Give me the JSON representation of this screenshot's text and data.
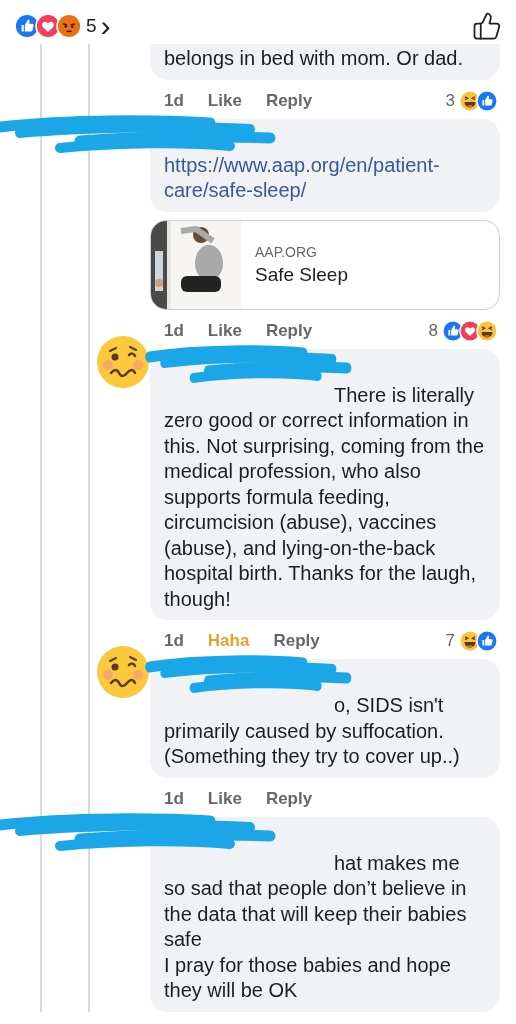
{
  "header": {
    "reactions": [
      {
        "kind": "like"
      },
      {
        "kind": "love"
      },
      {
        "kind": "angry"
      }
    ],
    "count": "5",
    "chevron": "›"
  },
  "comments": [
    {
      "redacted": false,
      "avatar_sticker": false,
      "text": "belongs in bed with mom. Or dad.",
      "time": "1d",
      "like": {
        "label": "Like",
        "selected": false
      },
      "reply": "Reply",
      "reaction_count": "3",
      "reactions": [
        {
          "kind": "haha"
        },
        {
          "kind": "like"
        }
      ]
    },
    {
      "redacted": true,
      "avatar_sticker": false,
      "text": "https://www.aap.org/en/patient-care/safe-sleep/",
      "link_preview": {
        "kind": "picture",
        "domain": "AAP.ORG",
        "title": "Safe Sleep"
      },
      "time": "1d",
      "like": {
        "label": "Like",
        "selected": false
      },
      "reply": "Reply",
      "reaction_count": "8",
      "reactions": [
        {
          "kind": "like"
        },
        {
          "kind": "love"
        },
        {
          "kind": "haha"
        }
      ]
    },
    {
      "redacted": true,
      "avatar_sticker": true,
      "text": "There is literally zero good or correct information in this. Not surprising, coming from the medical profession, who also supports formula feeding, circumcision (abuse), vaccines (abuse), and lying-on-the-back hospital birth. Thanks for the laugh, though!",
      "time": "1d",
      "like": {
        "label": "Haha",
        "selected": true
      },
      "reply": "Reply",
      "reaction_count": "7",
      "reactions": [
        {
          "kind": "haha"
        },
        {
          "kind": "like"
        }
      ]
    },
    {
      "redacted": true,
      "avatar_sticker": true,
      "text": "o, SIDS isn't primarily caused by suffocation. (Something they try to cover up..)",
      "time": "1d",
      "like": {
        "label": "Like",
        "selected": false
      },
      "reply": "Reply"
    },
    {
      "redacted": true,
      "avatar_sticker": false,
      "text": "hat makes me so sad that people don’t believe in the data that will keep their babies safe\nI pray for those babies and hope they will be OK"
    }
  ]
}
